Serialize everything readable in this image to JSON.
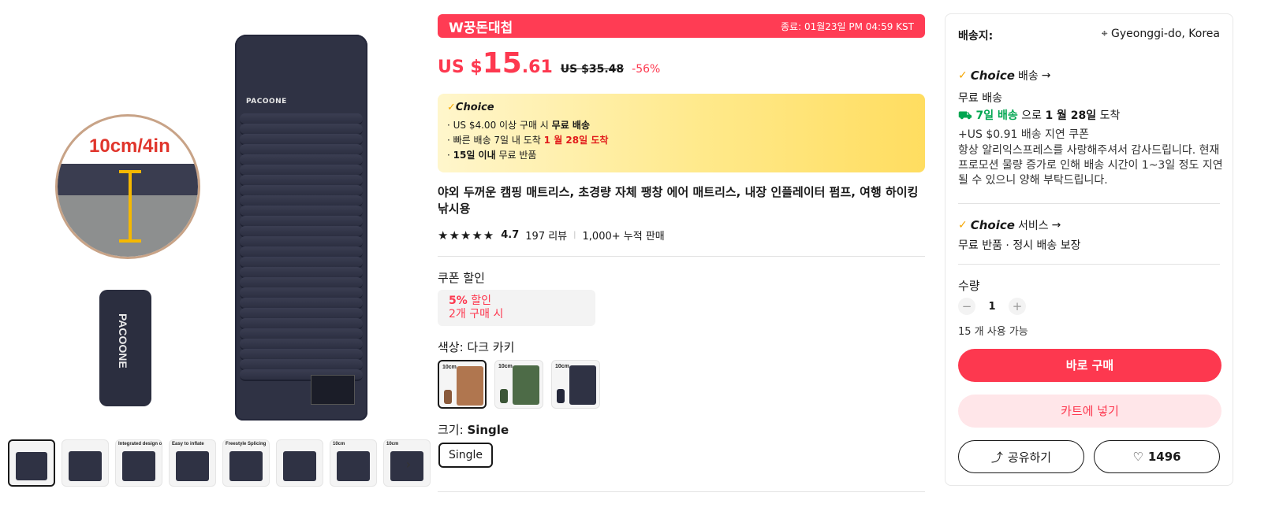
{
  "gallery": {
    "zoom_text": "10cm/4in",
    "mat_brand": "PACOONE",
    "bag_brand": "PACOONE",
    "thumbnails": [
      {
        "caption": ""
      },
      {
        "caption": ""
      },
      {
        "caption": "Integrated design of pillow"
      },
      {
        "caption": "Easy to inflate"
      },
      {
        "caption": "Freestyle Splicing"
      },
      {
        "caption": ""
      },
      {
        "caption": "10cm"
      },
      {
        "caption": "10cm"
      }
    ],
    "next_icon": "chevron-right-icon"
  },
  "promo": {
    "title": "W꿍돈대첩",
    "ends": "종료: 01월23일 PM 04:59 KST"
  },
  "price": {
    "currency": "US $",
    "integer": "15",
    "decimal": ".61",
    "original": "US $35.48",
    "discount": "-56%"
  },
  "choice_box": {
    "logo": "Choice",
    "line1_prefix": "· US $4.00 이상 구매 시 ",
    "line1_bold": "무료 배송",
    "line2_prefix": "· 빠른 배송 7일 내 도착 ",
    "line2_red": "1 월 28일 도착",
    "line3_bold": "15일 이내",
    "line3_suffix": " 무료 반품"
  },
  "product": {
    "title": "야외 두꺼운 캠핑 매트리스, 초경량 자체 팽창 에어 매트리스, 내장 인플레이터 펌프, 여행 하이킹 낚시용",
    "rating": "4.7",
    "stars": "★★★★★",
    "reviews": "197 리뷰",
    "sold": "1,000+ 누적 판매"
  },
  "coupon": {
    "label": "쿠폰 할인",
    "pct": "5%",
    "off": " 할인",
    "condition": "2개 구매 시"
  },
  "color": {
    "label": "색상: 다크 카키",
    "options": [
      {
        "caption": "10cm",
        "swatch": "#b0764f",
        "mini": "#8a5a3b"
      },
      {
        "caption": "10cm",
        "swatch": "#4d6b47",
        "mini": "#3c5637"
      },
      {
        "caption": "10cm",
        "swatch": "#2f3244",
        "mini": "#24273a"
      }
    ]
  },
  "size": {
    "label_prefix": "크기: ",
    "label_value": "Single",
    "option": "Single"
  },
  "shipping": {
    "label": "배송지:",
    "location": "Gyeonggi-do, Korea",
    "choice_logo": "Choice",
    "delivery_label": "배송",
    "free": "무료 배송",
    "eta_green": "7일 배송",
    "eta_mid": " 으로 ",
    "eta_bold": "1 월 28일",
    "eta_suffix": " 도착",
    "delay_coupon": "+US $0.91 배송 지연 쿠폰",
    "note": "항상 알리익스프레스를 사랑해주셔서 감사드립니다. 현재 프로모션 물량 증가로 인해 배송 시간이 1~3일 정도 지연될 수 있으니 양해 부탁드립니다."
  },
  "service": {
    "choice_logo": "Choice",
    "label": "서비스",
    "text": "무료 반품 · 정시 배송 보장"
  },
  "quantity": {
    "label": "수량",
    "minus": "−",
    "value": "1",
    "plus": "+",
    "stock": "15 개 사용 가능"
  },
  "actions": {
    "buy": "바로 구매",
    "cart": "카트에 넣기",
    "share": "공유하기",
    "wishlist_count": "1496"
  },
  "colors": {
    "accent": "#fd384f",
    "choice_gold": "#ffdd60",
    "green": "#00a651"
  }
}
